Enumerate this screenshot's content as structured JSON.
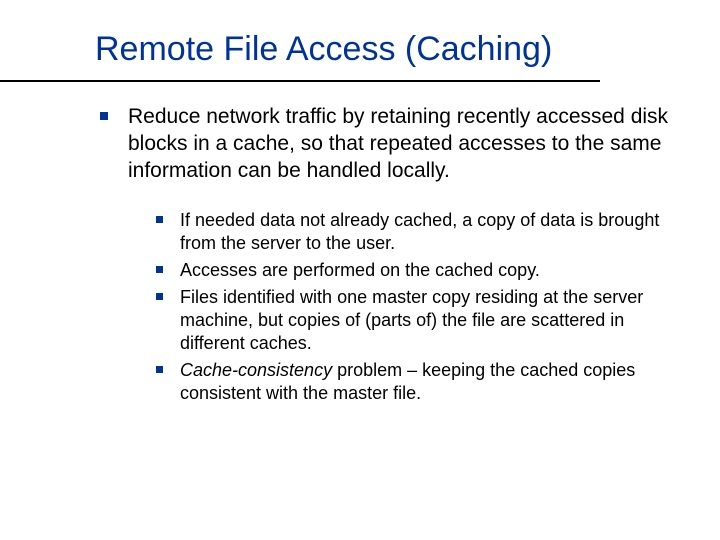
{
  "title": "Remote File Access (Caching)",
  "main_point": "Reduce network traffic by retaining recently accessed disk blocks in a cache, so that repeated accesses to the same information can be handled locally.",
  "sub_points": {
    "p0": "If needed data not already cached, a copy of data is brought from the server to the user.",
    "p1": "Accesses are performed on the cached copy.",
    "p2": "Files identified with one master copy residing at the server machine, but copies of (parts of) the file are scattered in different caches.",
    "p3_italic": "Cache-consistency",
    "p3_rest": " problem – keeping the cached copies consistent with the master file."
  }
}
